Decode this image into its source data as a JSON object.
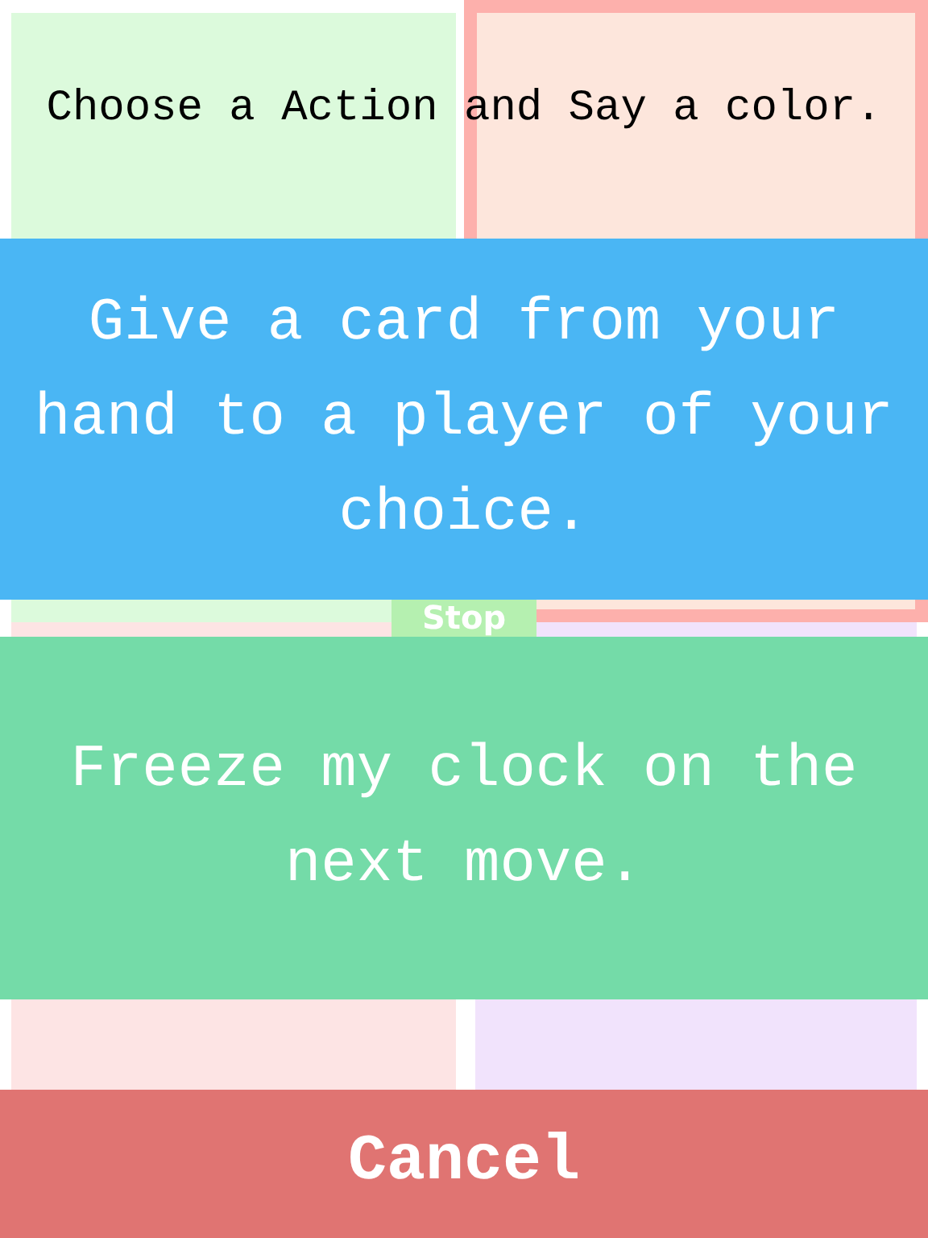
{
  "prompt": "Choose a Action and Say a color.",
  "players": [
    {
      "color": "#dcfadc",
      "active": false
    },
    {
      "color": "#fde6dc",
      "active": true
    },
    {
      "color": "#fde4e4",
      "active": false
    },
    {
      "color": "#f1e3fc",
      "active": false
    }
  ],
  "stop_button": "Stop",
  "actions": [
    {
      "text": "Give a card from your hand to a player of your choice.",
      "color": "#4ab6f4"
    },
    {
      "text": "Freeze my clock on the next move.",
      "color": "#74dba8"
    }
  ],
  "cancel_button": "Cancel"
}
